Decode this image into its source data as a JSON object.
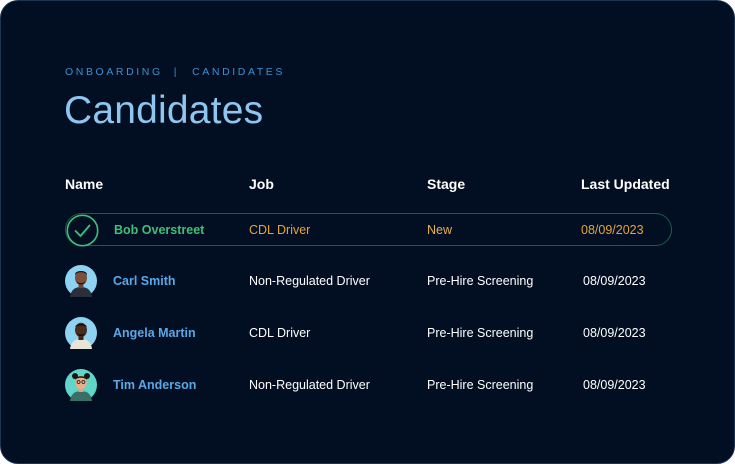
{
  "breadcrumb": {
    "section": "ONBOARDING",
    "separator": "|",
    "page": "CANDIDATES"
  },
  "title": "Candidates",
  "table": {
    "headers": {
      "name": "Name",
      "job": "Job",
      "stage": "Stage",
      "last_updated": "Last Updated"
    },
    "rows": [
      {
        "name": "Bob Overstreet",
        "job": "CDL Driver",
        "stage": "New",
        "last_updated": "08/09/2023",
        "selected": true,
        "icon": "check-circle-icon"
      },
      {
        "name": "Carl Smith",
        "job": "Non-Regulated Driver",
        "stage": "Pre-Hire Screening",
        "last_updated": "08/09/2023",
        "selected": false,
        "icon": "avatar"
      },
      {
        "name": "Angela Martin",
        "job": "CDL Driver",
        "stage": "Pre-Hire Screening",
        "last_updated": "08/09/2023",
        "selected": false,
        "icon": "avatar"
      },
      {
        "name": "Tim Anderson",
        "job": "Non-Regulated Driver",
        "stage": "Pre-Hire Screening",
        "last_updated": "08/09/2023",
        "selected": false,
        "icon": "avatar"
      }
    ]
  },
  "colors": {
    "background": "#020f22",
    "accent_blue": "#5aa8e6",
    "selected_green": "#3fbf78",
    "selected_orange": "#e7a334"
  }
}
